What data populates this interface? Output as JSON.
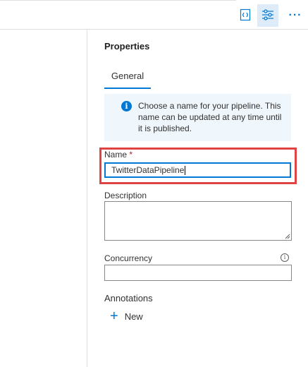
{
  "toolbar": {
    "code_icon": "code-icon",
    "properties_icon": "properties-sliders-icon",
    "more_label": "···"
  },
  "panel": {
    "title": "Properties",
    "tabs": [
      {
        "label": "General",
        "selected": true
      }
    ],
    "info_message": "Choose a name for your pipeline. This name can be updated at any time until it is published.",
    "info_icon_glyph": "i",
    "name_field": {
      "label": "Name",
      "required_marker": "*",
      "value": "TwitterDataPipeline"
    },
    "description_field": {
      "label": "Description",
      "value": ""
    },
    "concurrency_field": {
      "label": "Concurrency",
      "value": "",
      "info_glyph": "i"
    },
    "annotations": {
      "label": "Annotations",
      "new_button_label": "New",
      "plus_glyph": "+"
    }
  },
  "colors": {
    "accent": "#0078d4",
    "highlight_border": "#e04343",
    "info_bg": "#eff6fc"
  }
}
